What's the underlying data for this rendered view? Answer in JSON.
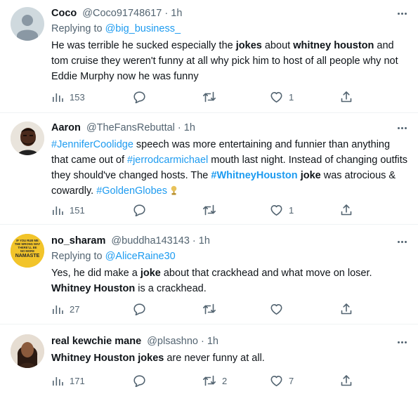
{
  "tweets": [
    {
      "name": "Coco",
      "handle": "@Coco91748617",
      "time": "1h",
      "reply_prefix": "Replying to ",
      "reply_to": "@big_business_",
      "body": [
        {
          "t": "He was terrible he sucked especially the "
        },
        {
          "t": "jokes",
          "b": true
        },
        {
          "t": " about "
        },
        {
          "t": "whitney houston",
          "b": true
        },
        {
          "t": " and tom cruise they weren't funny at all why pick him to host of all people why not Eddie Murphy now he was funny"
        }
      ],
      "views": "153",
      "replies": "",
      "retweets": "",
      "likes": "1",
      "avatar": "default-avatar"
    },
    {
      "name": "Aaron",
      "handle": "@TheFansRebuttal",
      "time": "1h",
      "body": [
        {
          "t": "#JenniferCoolidge",
          "l": true
        },
        {
          "t": " speech was more entertaining and funnier than anything that came out of "
        },
        {
          "t": "#jerrodcarmichael",
          "l": true
        },
        {
          "t": " mouth last night. Instead of changing outfits they should've changed hosts. The "
        },
        {
          "t": "#WhitneyHouston",
          "l": true,
          "b": true
        },
        {
          "t": " "
        },
        {
          "t": "joke",
          "b": true
        },
        {
          "t": " was atrocious & cowardly. "
        },
        {
          "t": "#GoldenGlobes",
          "l": true
        }
      ],
      "views": "151",
      "replies": "",
      "retweets": "",
      "likes": "1",
      "avatar": "man-avatar",
      "emoji": "golden-globe-emoji"
    },
    {
      "name": "no_sharam",
      "handle": "@buddha143143",
      "time": "1h",
      "reply_prefix": "Replying to ",
      "reply_to": "@AliceRaine30",
      "body": [
        {
          "t": "Yes, he did make a "
        },
        {
          "t": "joke",
          "b": true
        },
        {
          "t": " about that crackhead and what move on loser. "
        },
        {
          "t": "Whitney Houston",
          "b": true
        },
        {
          "t": " is a crackhead."
        }
      ],
      "views": "27",
      "replies": "",
      "retweets": "",
      "likes": "",
      "avatar": "namaste-avatar",
      "avatar_text": {
        "line1": "IF YOU RUB ME",
        "line2": "THE WRONG WAY",
        "line3": "THERE'LL BE",
        "line4": "NO MORE",
        "line5": "NAMASTE"
      }
    },
    {
      "name": "real kewchie mane",
      "handle": "@plsashno",
      "time": "1h",
      "body": [
        {
          "t": "Whitney Houston",
          "b": true
        },
        {
          "t": " "
        },
        {
          "t": "jokes",
          "b": true
        },
        {
          "t": " are never funny at all."
        }
      ],
      "views": "171",
      "replies": "",
      "retweets": "2",
      "likes": "7",
      "avatar": "woman-avatar"
    }
  ],
  "separator": " · ",
  "colors": {
    "text": "#0f1419",
    "secondary": "#536471",
    "link": "#1d9bf0",
    "divider": "#eff3f4"
  }
}
